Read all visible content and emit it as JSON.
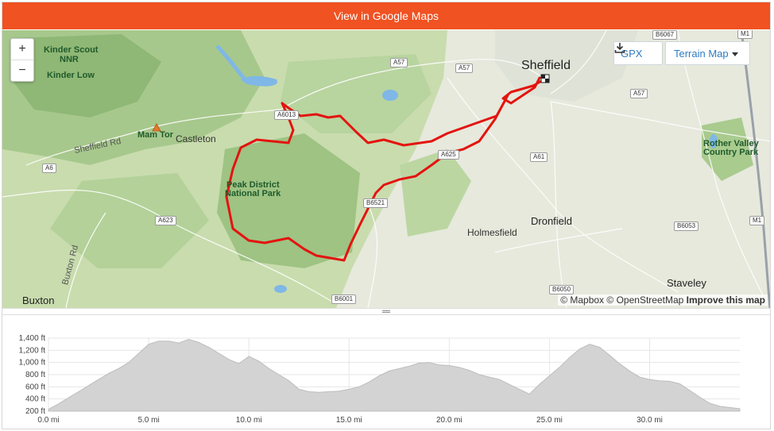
{
  "header": {
    "google_maps_label": "View in Google Maps"
  },
  "controls": {
    "zoom_in": "+",
    "zoom_out": "−",
    "gpx_label": "GPX",
    "map_type_label": "Terrain Map"
  },
  "map": {
    "labels": {
      "kinder_scout": "Kinder Scout",
      "nnr": "NNR",
      "kinder_low": "Kinder Low",
      "mam_tor": "Mam Tor",
      "castleton": "Castleton",
      "sheffield_rd": "Sheffield Rd",
      "peak_district_1": "Peak District",
      "peak_district_2": "National Park",
      "buxton_rd": "Buxton Rd",
      "buxton": "Buxton",
      "sheffield": "Sheffield",
      "rother_valley_1": "Rother Valley",
      "rother_valley_2": "Country Park",
      "dronfield": "Dronfield",
      "holmesfield": "Holmesfield",
      "staveley": "Staveley"
    },
    "roads": {
      "a57_1": "A57",
      "a57_2": "A57",
      "a57_3": "A57",
      "a6013": "A6013",
      "a625": "A625",
      "a61": "A61",
      "a6": "A6",
      "a623": "A623",
      "b6521": "B6521",
      "b6001": "B6001",
      "b6050": "B6050",
      "b6053": "B6053",
      "b6067": "B6067",
      "m1_1": "M1",
      "m1_2": "M1"
    },
    "attribution": {
      "mapbox": "© Mapbox",
      "osm": "© OpenStreetMap",
      "improve": "Improve this map"
    }
  },
  "elevation_chart": {
    "y_ticks": [
      "1,400 ft",
      "1,200 ft",
      "1,000 ft",
      "800 ft",
      "600 ft",
      "400 ft",
      "200 ft"
    ],
    "x_ticks": [
      "0.0 mi",
      "5.0 mi",
      "10.0 mi",
      "15.0 mi",
      "20.0 mi",
      "25.0 mi",
      "30.0 mi"
    ]
  },
  "chart_data": {
    "type": "area",
    "xlabel": "",
    "ylabel": "",
    "x_unit": "mi",
    "y_unit": "ft",
    "xlim": [
      0,
      34.5
    ],
    "ylim": [
      200,
      1400
    ],
    "grid": true,
    "fill_color": "#d3d3d3",
    "line_color": "#bdbdbd",
    "x": [
      0,
      0.5,
      1,
      1.5,
      2,
      2.5,
      3,
      3.5,
      4,
      4.5,
      5,
      5.5,
      6,
      6.5,
      7,
      7.5,
      8,
      8.5,
      9,
      9.5,
      10,
      10.5,
      11,
      11.5,
      12,
      12.5,
      13,
      13.5,
      14,
      14.5,
      15,
      15.5,
      16,
      16.5,
      17,
      17.5,
      18,
      18.5,
      19,
      19.5,
      20,
      20.5,
      21,
      21.5,
      22,
      22.5,
      23,
      23.5,
      24,
      24.5,
      25,
      25.5,
      26,
      26.5,
      27,
      27.5,
      28,
      28.5,
      29,
      29.5,
      30,
      30.5,
      31,
      31.5,
      32,
      32.5,
      33,
      33.5,
      34,
      34.5
    ],
    "y": [
      230,
      320,
      420,
      520,
      620,
      720,
      820,
      900,
      1000,
      1150,
      1300,
      1350,
      1350,
      1320,
      1380,
      1330,
      1250,
      1150,
      1050,
      980,
      1100,
      1020,
      900,
      800,
      700,
      560,
      520,
      510,
      520,
      530,
      560,
      600,
      680,
      780,
      860,
      900,
      940,
      990,
      1000,
      960,
      950,
      920,
      870,
      800,
      760,
      720,
      640,
      560,
      480,
      640,
      780,
      920,
      1080,
      1220,
      1300,
      1250,
      1120,
      980,
      860,
      760,
      720,
      700,
      690,
      650,
      540,
      430,
      330,
      280,
      260,
      240
    ]
  }
}
